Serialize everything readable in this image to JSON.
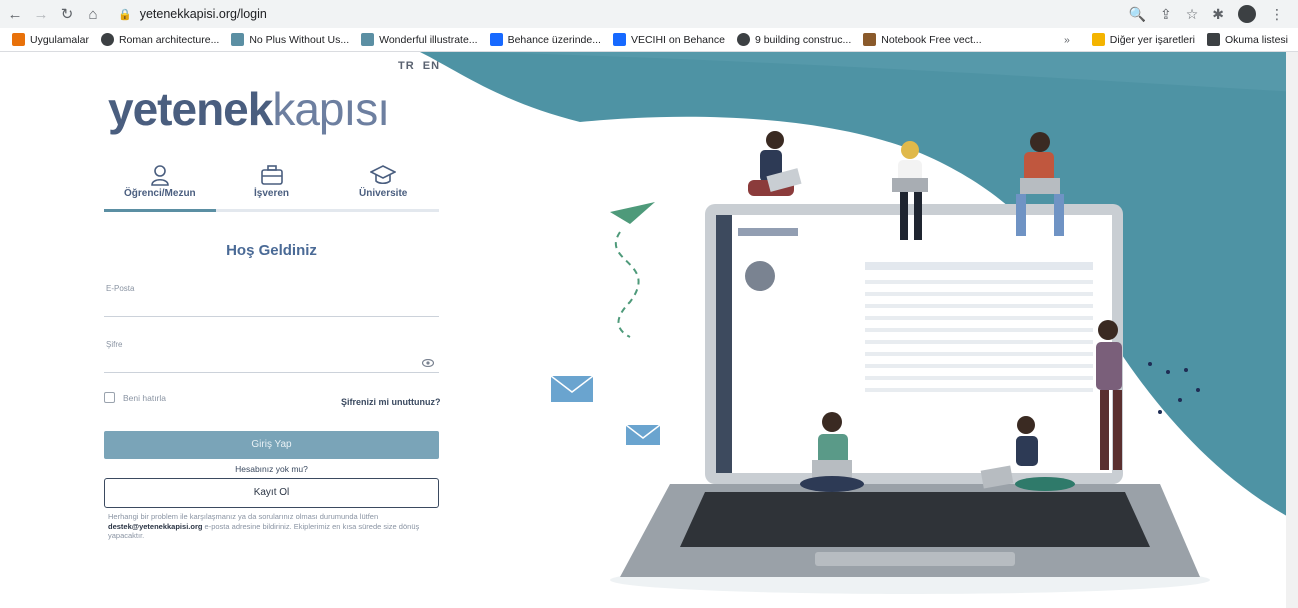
{
  "browser": {
    "url": "yetenekkapisi.org/login",
    "bookmarks": [
      {
        "label": "Uygulamalar",
        "color": "#e8710a"
      },
      {
        "label": "Roman architecture...",
        "color": "#3c4043"
      },
      {
        "label": "No Plus Without Us...",
        "color": "#5b8fa3"
      },
      {
        "label": "Wonderful illustrate...",
        "color": "#5b8fa3"
      },
      {
        "label": "Behance üzerinde...",
        "color": "#1769ff"
      },
      {
        "label": "VECIHI on Behance",
        "color": "#1769ff"
      },
      {
        "label": "9 building construc...",
        "color": "#3c4043"
      },
      {
        "label": "Notebook Free vect...",
        "color": "#8a5a2b"
      }
    ],
    "other_bookmarks": "Diğer yer işaretleri",
    "reading_list": "Okuma listesi"
  },
  "header": {
    "lang_tr": "TR",
    "lang_en": "EN",
    "logo_bold": "yetenek",
    "logo_light": "kapısı"
  },
  "tabs": [
    {
      "label": "Öğrenci/Mezun",
      "icon": "user-icon"
    },
    {
      "label": "İşveren",
      "icon": "briefcase-icon"
    },
    {
      "label": "Üniversite",
      "icon": "graduation-cap-icon"
    }
  ],
  "form": {
    "welcome": "Hoş Geldiniz",
    "email_label": "E-Posta",
    "password_label": "Şifre",
    "remember_label": "Beni hatırla",
    "forgot_label": "Şifrenizi mi unuttunuz?",
    "login_button": "Giriş Yap",
    "no_account": "Hesabınız yok mu?",
    "register_button": "Kayıt Ol",
    "help_prefix": "Herhangi bir problem ile karşılaşmanız ya da sorularınız olması durumunda lütfen",
    "help_email": "destek@yetenekkapisi.org",
    "help_suffix": "e-posta adresine bildiriniz. Ekiplerimiz en kısa sürede size dönüş yapacaktır."
  },
  "colors": {
    "brand": "#4a5e7f",
    "accent": "#5b8fa3",
    "login_button": "#7aa4b8",
    "hero_teal": "#4e93a4"
  }
}
